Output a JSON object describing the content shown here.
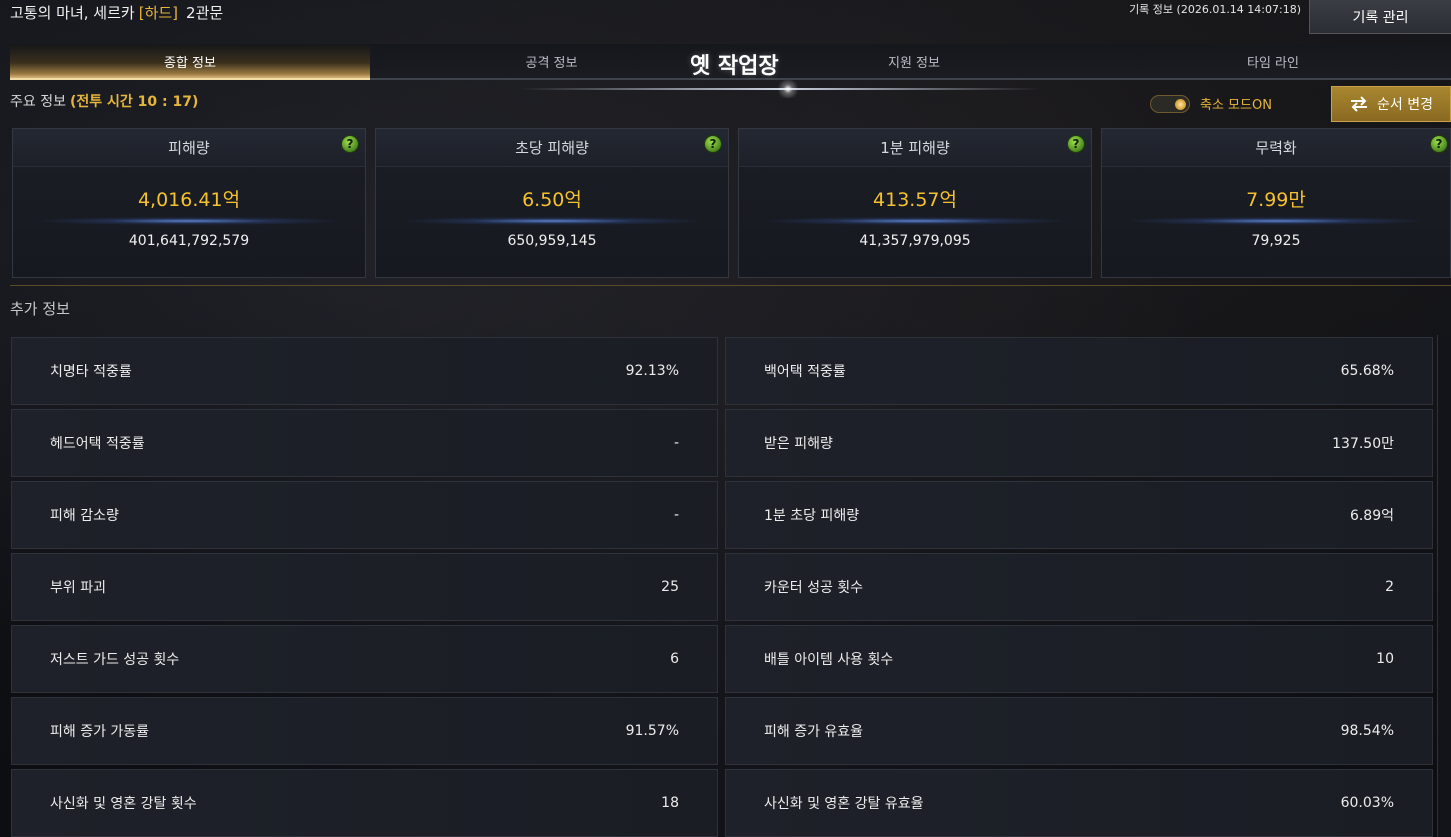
{
  "header": {
    "boss_name": "고통의 마녀, 세르카",
    "difficulty": "[하드]",
    "gate": "2관문",
    "record_info": "기록 정보 (2026.01.14 14:07:18)",
    "record_manage_label": "기록 관리"
  },
  "tabs": [
    {
      "label": "종합 정보",
      "active": true
    },
    {
      "label": "공격 정보",
      "active": false
    },
    {
      "label": "지원 정보",
      "active": false
    },
    {
      "label": "타임 라인",
      "active": false
    }
  ],
  "center_title": "옛 작업장",
  "main_info": {
    "label": "주요 정보",
    "battle_time": "(전투 시간 10 : 17)",
    "compact_mode_label": "축소 모드ON",
    "compact_mode_on": true,
    "order_change_label": "순서 변경"
  },
  "stat_cards": [
    {
      "title": "피해량",
      "value": "4,016.41억",
      "raw": "401,641,792,579",
      "help": "?"
    },
    {
      "title": "초당 피해량",
      "value": "6.50억",
      "raw": "650,959,145",
      "help": "?"
    },
    {
      "title": "1분 피해량",
      "value": "413.57억",
      "raw": "41,357,979,095",
      "help": "?"
    },
    {
      "title": "무력화",
      "value": "7.99만",
      "raw": "79,925",
      "help": "?"
    }
  ],
  "extra_info": {
    "label": "추가 정보",
    "rows": [
      {
        "left_label": "치명타 적중률",
        "left_value": "92.13%",
        "right_label": "백어택 적중률",
        "right_value": "65.68%"
      },
      {
        "left_label": "헤드어택 적중률",
        "left_value": "-",
        "right_label": "받은 피해량",
        "right_value": "137.50만"
      },
      {
        "left_label": "피해 감소량",
        "left_value": "-",
        "right_label": "1분 초당 피해량",
        "right_value": "6.89억"
      },
      {
        "left_label": "부위 파괴",
        "left_value": "25",
        "right_label": "카운터 성공 횟수",
        "right_value": "2"
      },
      {
        "left_label": "저스트 가드 성공 횟수",
        "left_value": "6",
        "right_label": "배틀 아이템 사용 횟수",
        "right_value": "10"
      },
      {
        "left_label": "피해 증가 가동률",
        "left_value": "91.57%",
        "right_label": "피해 증가 유효율",
        "right_value": "98.54%"
      },
      {
        "left_label": "사신화 및 영혼 강탈 횟수",
        "left_value": "18",
        "right_label": "사신화 및 영혼 강탈 유효율",
        "right_value": "60.03%"
      }
    ]
  },
  "colors": {
    "accent_gold": "#e7b53a",
    "value_gold": "#f5c12f",
    "help_green": "#6fb22a",
    "order_button": "#a8862f"
  },
  "icons": {
    "help": "question-icon",
    "order": "swap-arrows-icon"
  }
}
